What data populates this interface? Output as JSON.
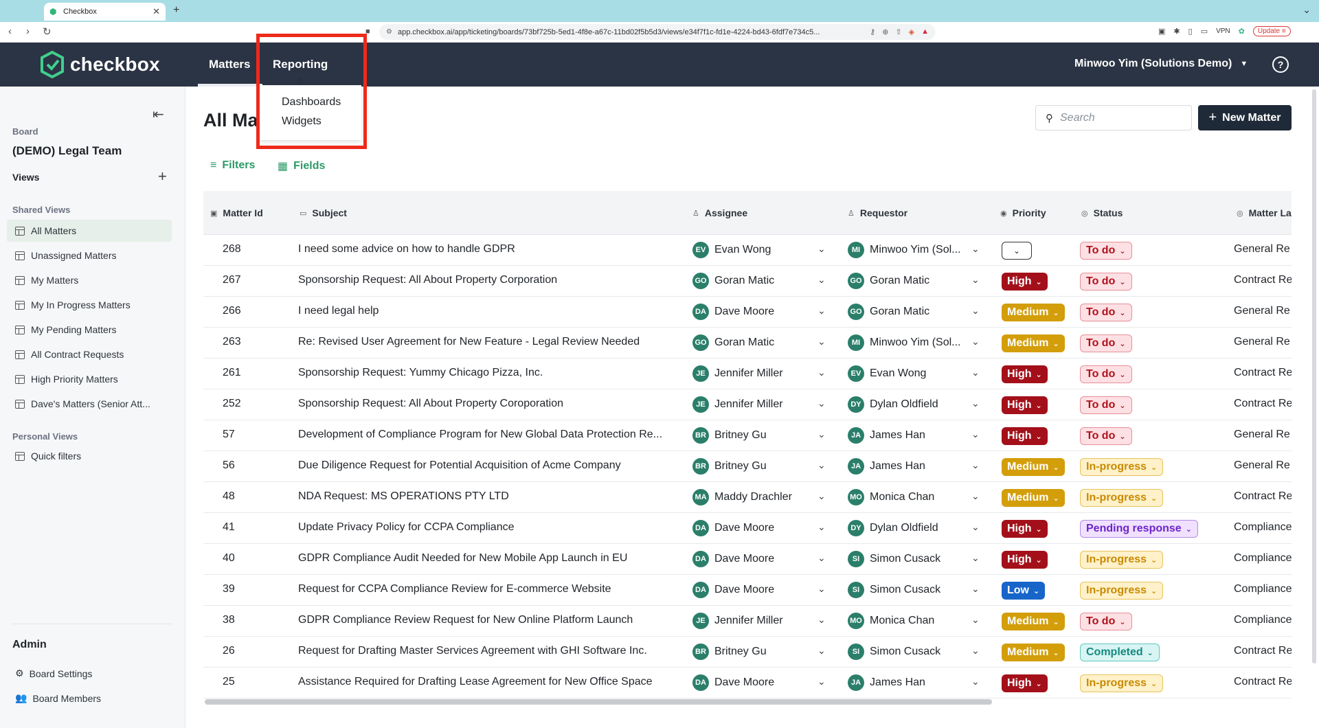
{
  "browser": {
    "tab_title": "Checkbox",
    "url": "app.checkbox.ai/app/ticketing/boards/73bf725b-5ed1-4f8e-a67c-11bd02f5b5d3/views/e34f7f1c-fd1e-4224-bd43-6fdf7e734c5...",
    "vpn_label": "VPN",
    "update_label": "Update"
  },
  "header": {
    "logo_text": "checkbox",
    "nav": {
      "matters": "Matters",
      "reporting": "Reporting"
    },
    "user": "Minwoo Yim (Solutions Demo)",
    "help": "?"
  },
  "reporting_menu": {
    "dashboards": "Dashboards",
    "widgets": "Widgets"
  },
  "sidebar": {
    "board_label": "Board",
    "board_name": "(DEMO) Legal Team",
    "views_label": "Views",
    "shared_views_label": "Shared Views",
    "shared_views": [
      "All Matters",
      "Unassigned Matters",
      "My Matters",
      "My In Progress Matters",
      "My Pending Matters",
      "All Contract Requests",
      "High Priority Matters",
      "Dave's Matters (Senior Att..."
    ],
    "personal_views_label": "Personal Views",
    "personal_views": [
      "Quick filters"
    ],
    "admin_label": "Admin",
    "admin_items": [
      "Board Settings",
      "Board Members"
    ]
  },
  "main": {
    "title": "All Mat",
    "search_placeholder": "Search",
    "new_matter": "New Matter",
    "filters": "Filters",
    "fields": "Fields"
  },
  "table": {
    "columns": [
      "Matter Id",
      "Subject",
      "Assignee",
      "Requestor",
      "Priority",
      "Status",
      "Matter La"
    ],
    "rows": [
      {
        "id": "268",
        "subject": "I need some advice on how to handle GDPR",
        "assignee": "Evan Wong",
        "assignee_initials": "EV",
        "requestor": "Minwoo Yim (Sol...",
        "requestor_initials": "MI",
        "priority": "",
        "status": "To do",
        "label": "General Re"
      },
      {
        "id": "267",
        "subject": "Sponsorship Request: All About Property Corporation",
        "assignee": "Goran Matic",
        "assignee_initials": "GO",
        "requestor": "Goran Matic",
        "requestor_initials": "GO",
        "priority": "High",
        "status": "To do",
        "label": "Contract Re"
      },
      {
        "id": "266",
        "subject": "I need legal help",
        "assignee": "Dave Moore",
        "assignee_initials": "DA",
        "requestor": "Goran Matic",
        "requestor_initials": "GO",
        "priority": "Medium",
        "status": "To do",
        "label": "General Re"
      },
      {
        "id": "263",
        "subject": "Re: Revised User Agreement for New Feature - Legal Review Needed",
        "assignee": "Goran Matic",
        "assignee_initials": "GO",
        "requestor": "Minwoo Yim (Sol...",
        "requestor_initials": "MI",
        "priority": "Medium",
        "status": "To do",
        "label": "General Re"
      },
      {
        "id": "261",
        "subject": "Sponsorship Request: Yummy Chicago Pizza, Inc.",
        "assignee": "Jennifer Miller",
        "assignee_initials": "JE",
        "requestor": "Evan Wong",
        "requestor_initials": "EV",
        "priority": "High",
        "status": "To do",
        "label": "Contract Re"
      },
      {
        "id": "252",
        "subject": "Sponsorship Request: All About Property Coroporation",
        "assignee": "Jennifer Miller",
        "assignee_initials": "JE",
        "requestor": "Dylan Oldfield",
        "requestor_initials": "DY",
        "priority": "High",
        "status": "To do",
        "label": "Contract Re"
      },
      {
        "id": "57",
        "subject": "Development of Compliance Program for New Global Data Protection Re...",
        "assignee": "Britney Gu",
        "assignee_initials": "BR",
        "requestor": "James Han",
        "requestor_initials": "JA",
        "priority": "High",
        "status": "To do",
        "label": "General Re"
      },
      {
        "id": "56",
        "subject": "Due Diligence Request for Potential Acquisition of Acme Company",
        "assignee": "Britney Gu",
        "assignee_initials": "BR",
        "requestor": "James Han",
        "requestor_initials": "JA",
        "priority": "Medium",
        "status": "In-progress",
        "label": "General Re"
      },
      {
        "id": "48",
        "subject": "NDA Request: MS OPERATIONS PTY LTD",
        "assignee": "Maddy Drachler",
        "assignee_initials": "MA",
        "requestor": "Monica Chan",
        "requestor_initials": "MO",
        "priority": "Medium",
        "status": "In-progress",
        "label": "Contract Re"
      },
      {
        "id": "41",
        "subject": "Update Privacy Policy for CCPA Compliance",
        "assignee": "Dave Moore",
        "assignee_initials": "DA",
        "requestor": "Dylan Oldfield",
        "requestor_initials": "DY",
        "priority": "High",
        "status": "Pending response",
        "label": "Compliance"
      },
      {
        "id": "40",
        "subject": "GDPR Compliance Audit Needed for New Mobile App Launch in EU",
        "assignee": "Dave Moore",
        "assignee_initials": "DA",
        "requestor": "Simon Cusack",
        "requestor_initials": "SI",
        "priority": "High",
        "status": "In-progress",
        "label": "Compliance"
      },
      {
        "id": "39",
        "subject": "Request for CCPA Compliance Review for E-commerce Website",
        "assignee": "Dave Moore",
        "assignee_initials": "DA",
        "requestor": "Simon Cusack",
        "requestor_initials": "SI",
        "priority": "Low",
        "status": "In-progress",
        "label": "Compliance"
      },
      {
        "id": "38",
        "subject": "GDPR Compliance Review Request for New Online Platform Launch",
        "assignee": "Jennifer Miller",
        "assignee_initials": "JE",
        "requestor": "Monica Chan",
        "requestor_initials": "MO",
        "priority": "Medium",
        "status": "To do",
        "label": "Compliance"
      },
      {
        "id": "26",
        "subject": "Request for Drafting Master Services Agreement with GHI Software Inc.",
        "assignee": "Britney Gu",
        "assignee_initials": "BR",
        "requestor": "Simon Cusack",
        "requestor_initials": "SI",
        "priority": "Medium",
        "status": "Completed",
        "label": "Contract Re"
      },
      {
        "id": "25",
        "subject": "Assistance Required for Drafting Lease Agreement for New Office Space",
        "assignee": "Dave Moore",
        "assignee_initials": "DA",
        "requestor": "James Han",
        "requestor_initials": "JA",
        "priority": "High",
        "status": "In-progress",
        "label": "Contract Re"
      }
    ]
  },
  "colors": {
    "header_bg": "#2b3444",
    "accent_green": "#2b9a66",
    "highlight_red": "#ee2a1b"
  }
}
